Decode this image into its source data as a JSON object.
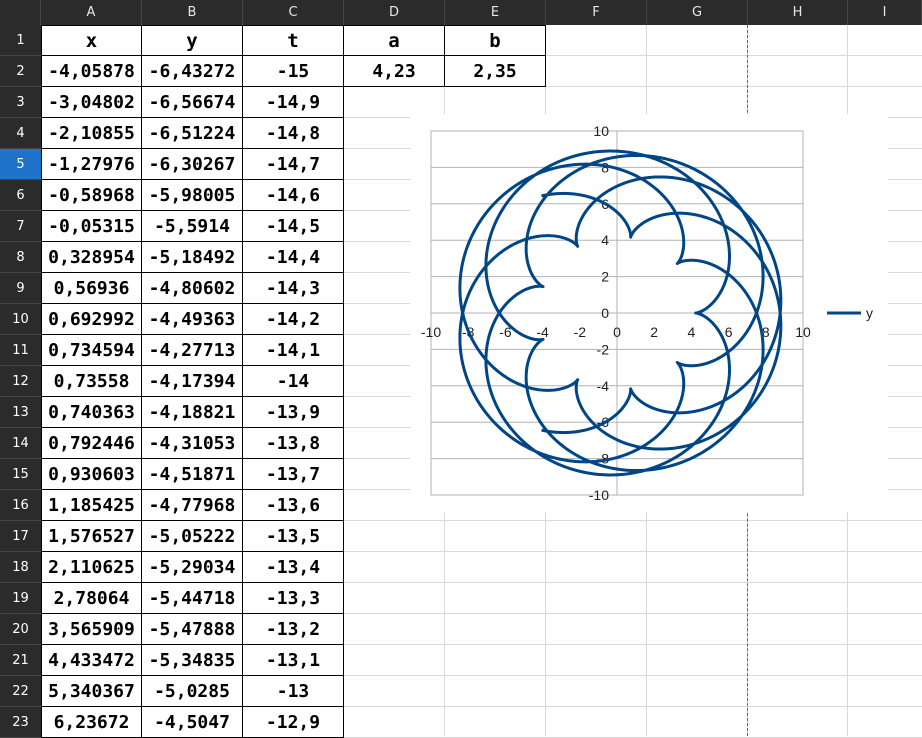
{
  "columns": [
    "A",
    "B",
    "C",
    "D",
    "E",
    "F",
    "G",
    "H",
    "I"
  ],
  "active_row": 5,
  "header_row": {
    "x": "x",
    "y": "y",
    "t": "t",
    "a": "a",
    "b": "b"
  },
  "params": {
    "a": "4,23",
    "b": "2,35"
  },
  "rows": [
    {
      "n": "1"
    },
    {
      "n": "2",
      "x": "-4,05878",
      "y": "-6,43272",
      "t": "-15"
    },
    {
      "n": "3",
      "x": "-3,04802",
      "y": "-6,56674",
      "t": "-14,9"
    },
    {
      "n": "4",
      "x": "-2,10855",
      "y": "-6,51224",
      "t": "-14,8"
    },
    {
      "n": "5",
      "x": "-1,27976",
      "y": "-6,30267",
      "t": "-14,7"
    },
    {
      "n": "6",
      "x": "-0,58968",
      "y": "-5,98005",
      "t": "-14,6"
    },
    {
      "n": "7",
      "x": "-0,05315",
      "y": "-5,5914",
      "t": "-14,5"
    },
    {
      "n": "8",
      "x": "0,328954",
      "y": "-5,18492",
      "t": "-14,4"
    },
    {
      "n": "9",
      "x": "0,56936",
      "y": "-4,80602",
      "t": "-14,3"
    },
    {
      "n": "10",
      "x": "0,692992",
      "y": "-4,49363",
      "t": "-14,2"
    },
    {
      "n": "11",
      "x": "0,734594",
      "y": "-4,27713",
      "t": "-14,1"
    },
    {
      "n": "12",
      "x": "0,73558",
      "y": "-4,17394",
      "t": "-14"
    },
    {
      "n": "13",
      "x": "0,740363",
      "y": "-4,18821",
      "t": "-13,9"
    },
    {
      "n": "14",
      "x": "0,792446",
      "y": "-4,31053",
      "t": "-13,8"
    },
    {
      "n": "15",
      "x": "0,930603",
      "y": "-4,51871",
      "t": "-13,7"
    },
    {
      "n": "16",
      "x": "1,185425",
      "y": "-4,77968",
      "t": "-13,6"
    },
    {
      "n": "17",
      "x": "1,576527",
      "y": "-5,05222",
      "t": "-13,5"
    },
    {
      "n": "18",
      "x": "2,110625",
      "y": "-5,29034",
      "t": "-13,4"
    },
    {
      "n": "19",
      "x": "2,78064",
      "y": "-5,44718",
      "t": "-13,3"
    },
    {
      "n": "20",
      "x": "3,565909",
      "y": "-5,47888",
      "t": "-13,2"
    },
    {
      "n": "21",
      "x": "4,433472",
      "y": "-5,34835",
      "t": "-13,1"
    },
    {
      "n": "22",
      "x": "5,340367",
      "y": "-5,0285",
      "t": "-13"
    },
    {
      "n": "23",
      "x": "6,23672",
      "y": "-4,5047",
      "t": "-12,9"
    }
  ],
  "chart_data": {
    "type": "scatter",
    "series": [
      {
        "name": "y",
        "color": "#004586",
        "x_column": "x",
        "y_column": "y"
      }
    ],
    "curve": "epicycloid: x = (a+b)cos(t) - b cos((a+b)t/b), y = (a+b)sin(t) - b sin((a+b)t/b)",
    "a": 4.23,
    "b": 2.35,
    "t_range": [
      -15,
      15
    ],
    "t_step": 0.1,
    "xlim": [
      -10,
      10
    ],
    "ylim": [
      -10,
      10
    ],
    "x_ticks": [
      "-10",
      "-8",
      "-6",
      "-4",
      "-2",
      "0",
      "2",
      "4",
      "6",
      "8",
      "10"
    ],
    "y_ticks": [
      "-10",
      "-8",
      "-6",
      "-4",
      "-2",
      "0",
      "2",
      "4",
      "6",
      "8",
      "10"
    ],
    "grid": true,
    "legend": "right",
    "axis_color": "#b3b3b3"
  }
}
